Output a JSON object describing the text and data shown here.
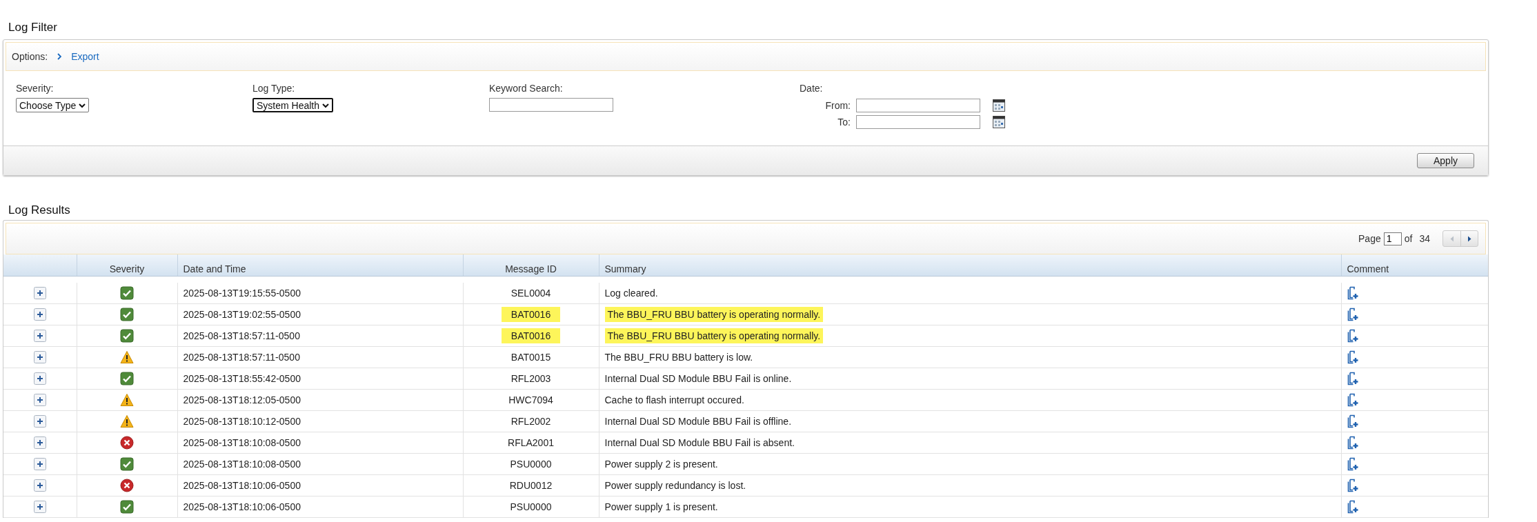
{
  "filter": {
    "title": "Log Filter",
    "options_label": "Options:",
    "export_link": "Export",
    "severity": {
      "label": "Severity:",
      "value": "Choose Type",
      "focused": false
    },
    "log_type": {
      "label": "Log Type:",
      "value": "System Health",
      "focused": true
    },
    "keyword": {
      "label": "Keyword Search:"
    },
    "date": {
      "label": "Date:",
      "from_label": "From:",
      "to_label": "To:"
    },
    "apply_button": "Apply"
  },
  "results": {
    "title": "Log Results",
    "pager": {
      "page_label": "Page",
      "page": "1",
      "of_label": "of",
      "total": "34",
      "prev_disabled": true
    },
    "columns": [
      "Severity",
      "Date and Time",
      "Message ID",
      "Summary",
      "Comment"
    ],
    "rows": [
      {
        "kind": "ok",
        "datetime": "2025-08-13T19:15:55-0500",
        "message_id": "SEL0004",
        "summary": "Log cleared.",
        "highlighted": false
      },
      {
        "kind": "ok",
        "datetime": "2025-08-13T19:02:55-0500",
        "message_id": "BAT0016",
        "summary": "The BBU_FRU BBU battery is operating normally.",
        "highlighted": true
      },
      {
        "kind": "ok",
        "datetime": "2025-08-13T18:57:11-0500",
        "message_id": "BAT0016",
        "summary": "The BBU_FRU BBU battery is operating normally.",
        "highlighted": true
      },
      {
        "kind": "warning",
        "datetime": "2025-08-13T18:57:11-0500",
        "message_id": "BAT0015",
        "summary": "The BBU_FRU BBU battery is low.",
        "highlighted": false
      },
      {
        "kind": "ok",
        "datetime": "2025-08-13T18:55:42-0500",
        "message_id": "RFL2003",
        "summary": "Internal Dual SD Module BBU Fail is online.",
        "highlighted": false
      },
      {
        "kind": "warning",
        "datetime": "2025-08-13T18:12:05-0500",
        "message_id": "HWC7094",
        "summary": "Cache to flash interrupt occured.",
        "highlighted": false
      },
      {
        "kind": "warning",
        "datetime": "2025-08-13T18:10:12-0500",
        "message_id": "RFL2002",
        "summary": "Internal Dual SD Module BBU Fail is offline.",
        "highlighted": false
      },
      {
        "kind": "critical",
        "datetime": "2025-08-13T18:10:08-0500",
        "message_id": "RFLA2001",
        "summary": "Internal Dual SD Module BBU Fail is absent.",
        "highlighted": false
      },
      {
        "kind": "ok",
        "datetime": "2025-08-13T18:10:08-0500",
        "message_id": "PSU0000",
        "summary": "Power supply 2 is present.",
        "highlighted": false
      },
      {
        "kind": "critical",
        "datetime": "2025-08-13T18:10:06-0500",
        "message_id": "RDU0012",
        "summary": "Power supply redundancy is lost.",
        "highlighted": false
      },
      {
        "kind": "ok",
        "datetime": "2025-08-13T18:10:06-0500",
        "message_id": "PSU0000",
        "summary": "Power supply 1 is present.",
        "highlighted": false
      }
    ]
  }
}
